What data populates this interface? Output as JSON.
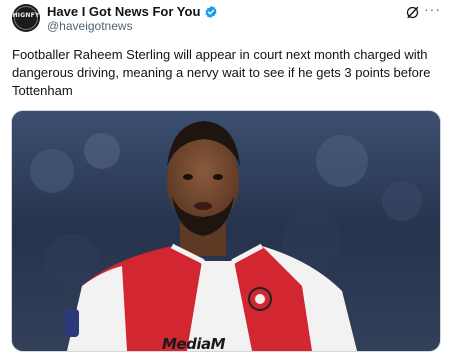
{
  "tweet": {
    "author": {
      "display_name": "Have I Got News For You",
      "handle": "@haveigotnews",
      "avatar_text": "HIGNFY",
      "verified_icon": "verified-badge-icon"
    },
    "actions": {
      "grok_icon": "grok-icon",
      "more_icon": "more-options-icon",
      "more_label": "···"
    },
    "text": "Footballer Raheem Sterling will appear in court next month charged with dangerous driving, meaning a nervy wait to see if he gets 3 points before Tottenham",
    "media": {
      "kind": "photo",
      "visible_text": "MediaM"
    }
  },
  "colors": {
    "verified_blue": "#1d9bf0",
    "handle_gray": "#536471",
    "text": "#0f1419",
    "shirt_red": "#d22630",
    "shirt_white": "#f2f2f2"
  }
}
